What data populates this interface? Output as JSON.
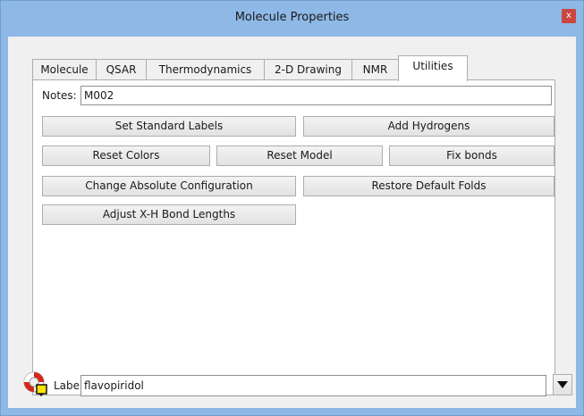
{
  "window": {
    "title": "Molecule Properties",
    "close_glyph": "x"
  },
  "tabs": [
    {
      "label": "Molecule",
      "active": false
    },
    {
      "label": "QSAR",
      "active": false
    },
    {
      "label": "Thermodynamics",
      "active": false
    },
    {
      "label": "2-D Drawing",
      "active": false
    },
    {
      "label": "NMR",
      "active": false
    },
    {
      "label": "Utilities",
      "active": true
    }
  ],
  "notes": {
    "label": "Notes:",
    "value": "M002"
  },
  "buttons": {
    "set_standard_labels": "Set Standard Labels",
    "add_hydrogens": "Add Hydrogens",
    "reset_colors": "Reset Colors",
    "reset_model": "Reset Model",
    "fix_bonds": "Fix bonds",
    "change_absolute_configuration": "Change Absolute Configuration",
    "restore_default_folds": "Restore Default Folds",
    "adjust_xh_bond_lengths": "Adjust X-H Bond Lengths"
  },
  "footer": {
    "label": "Label:",
    "value": "flavopiridol",
    "icon": "lifebuoy-icon"
  },
  "colors": {
    "titlebar": "#8eb8e6",
    "close": "#c9473f",
    "client": "#f0f0f0"
  }
}
